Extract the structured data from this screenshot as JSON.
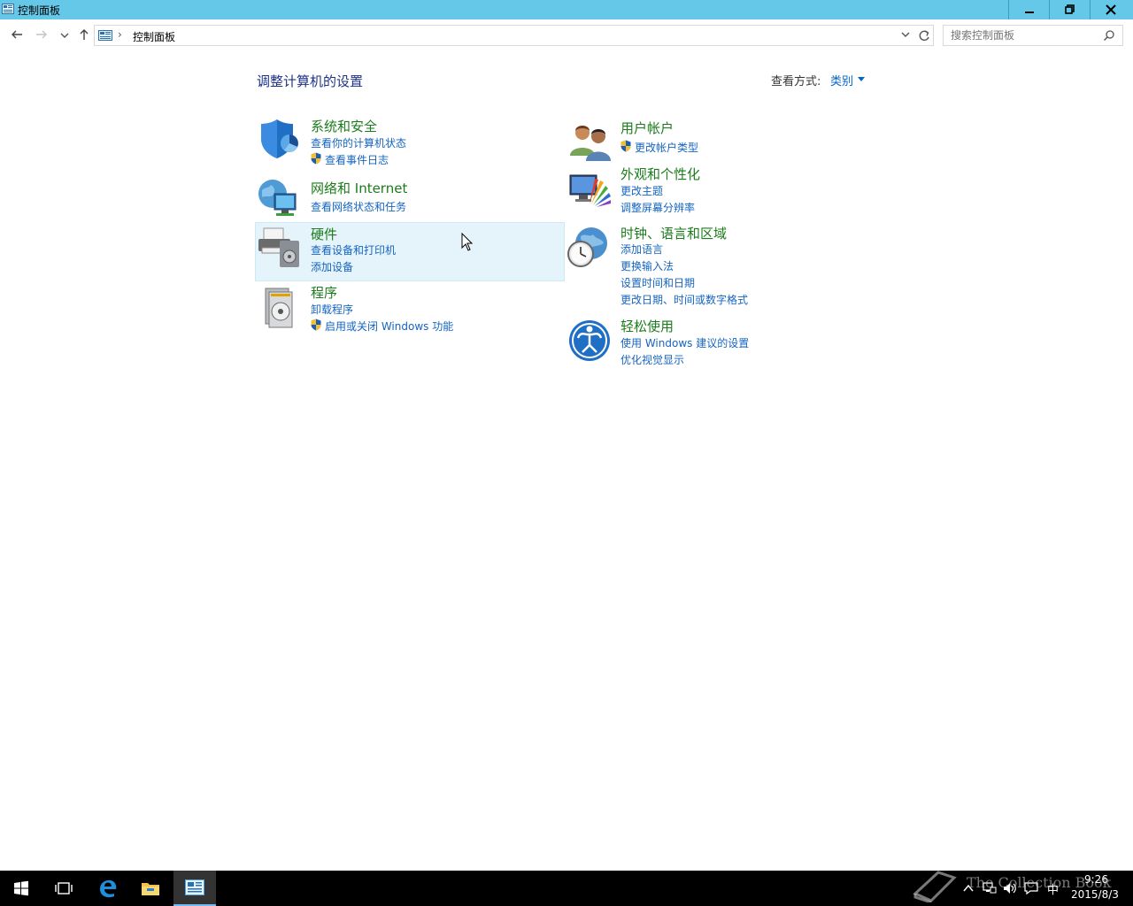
{
  "window": {
    "title": "控制面板",
    "minimize_icon": "minimize-icon",
    "maximize_icon": "restore-icon",
    "close_icon": "close-icon"
  },
  "nav": {
    "breadcrumb": [
      "控制面板"
    ],
    "search_placeholder": "搜索控制面板"
  },
  "main": {
    "title": "调整计算机的设置",
    "view_by_label": "查看方式:",
    "view_by_value": "类别"
  },
  "categories": [
    {
      "title": "系统和安全",
      "icon": "system-security-icon",
      "links": [
        {
          "label": "查看你的计算机状态",
          "shield": false
        },
        {
          "label": "查看事件日志",
          "shield": true
        }
      ]
    },
    {
      "title": "网络和 Internet",
      "icon": "network-internet-icon",
      "links": [
        {
          "label": "查看网络状态和任务",
          "shield": false
        }
      ]
    },
    {
      "title": "硬件",
      "icon": "hardware-icon",
      "links": [
        {
          "label": "查看设备和打印机",
          "shield": false
        },
        {
          "label": "添加设备",
          "shield": false
        }
      ]
    },
    {
      "title": "程序",
      "icon": "programs-icon",
      "links": [
        {
          "label": "卸载程序",
          "shield": false
        },
        {
          "label": "启用或关闭 Windows 功能",
          "shield": true
        }
      ]
    },
    {
      "title": "用户帐户",
      "icon": "user-accounts-icon",
      "links": [
        {
          "label": "更改帐户类型",
          "shield": true
        }
      ]
    },
    {
      "title": "外观和个性化",
      "icon": "appearance-icon",
      "links": [
        {
          "label": "更改主题",
          "shield": false
        },
        {
          "label": "调整屏幕分辨率",
          "shield": false
        }
      ]
    },
    {
      "title": "时钟、语言和区域",
      "icon": "clock-language-region-icon",
      "links": [
        {
          "label": "添加语言",
          "shield": false
        },
        {
          "label": "更换输入法",
          "shield": false
        },
        {
          "label": "设置时间和日期",
          "shield": false
        },
        {
          "label": "更改日期、时间或数字格式",
          "shield": false
        }
      ]
    },
    {
      "title": "轻松使用",
      "icon": "ease-of-access-icon",
      "links": [
        {
          "label": "使用 Windows 建议的设置",
          "shield": false
        },
        {
          "label": "优化视觉显示",
          "shield": false
        }
      ]
    }
  ],
  "taskbar": {
    "items": [
      "start-icon",
      "task-view-icon",
      "edge-icon",
      "file-explorer-icon",
      "control-panel-icon"
    ],
    "time": "9:26",
    "date": "2015/8/3",
    "ime": "中",
    "watermark": "The Collection Book"
  },
  "colors": {
    "titlebar": "#66c8e8",
    "category_title": "#1a7c1a",
    "link": "#1565c0",
    "heading": "#1e3287"
  }
}
